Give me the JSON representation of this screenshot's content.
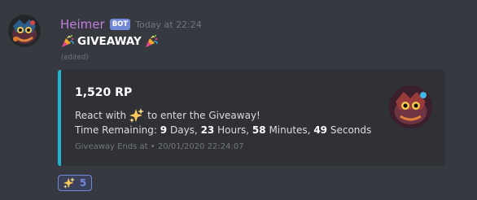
{
  "message": {
    "author": {
      "name": "Heimer",
      "tag": "BOT",
      "avatar_icon": "heimer-avatar"
    },
    "timestamp": "Today at 22:24",
    "content": {
      "emoji_left": "party-popper-icon",
      "text": "GIVEAWAY",
      "emoji_right": "party-popper-icon"
    },
    "edited_label": "(edited)"
  },
  "embed": {
    "accent_color": "#1fb6d4",
    "title": "1,520 RP",
    "description": {
      "line1_prefix": "React with",
      "line1_emoji": "sparkles-icon",
      "line1_suffix": "to enter the Giveaway!",
      "time_remaining_label": "Time Remaining:",
      "days": "9",
      "days_label": "Days,",
      "hours": "23",
      "hours_label": "Hours,",
      "minutes": "58",
      "minutes_label": "Minutes,",
      "seconds": "49",
      "seconds_label": "Seconds"
    },
    "footer": "Giveaway Ends at • 20/01/2020 22:24:07",
    "thumbnail_icon": "heimer-thumbnail"
  },
  "reaction": {
    "emoji": "sparkles-icon",
    "count": "5"
  },
  "colors": {
    "background": "#36393f",
    "embed_background": "#2f3136",
    "username": "#c27ee0",
    "bot_tag": "#7289da",
    "reaction_bg": "#3b405a"
  }
}
